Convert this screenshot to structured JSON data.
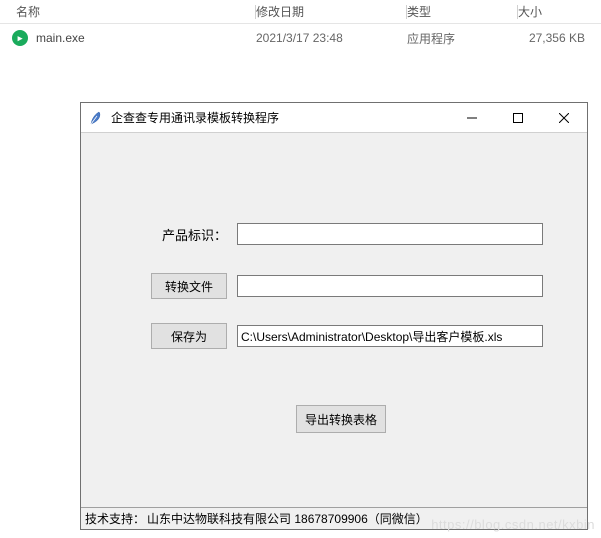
{
  "explorer": {
    "columns": {
      "name": "名称",
      "date": "修改日期",
      "type": "类型",
      "size": "大小"
    },
    "files": [
      {
        "name": "main.exe",
        "date": "2021/3/17 23:48",
        "type": "应用程序",
        "size": "27,356 KB"
      }
    ]
  },
  "window": {
    "title": "企查查专用通讯录模板转换程序",
    "labels": {
      "product_id": "产品标识：",
      "convert_file": "转换文件",
      "save_as": "保存为",
      "export": "导出转换表格"
    },
    "values": {
      "product_id": "",
      "convert_file": "",
      "save_as": "C:\\Users\\Administrator\\Desktop\\导出客户模板.xls"
    },
    "footer": {
      "label": "技术支持：",
      "text": "山东中达物联科技有限公司 18678709906（同微信）"
    }
  },
  "watermark": "https://blog.csdn.net/kxbin"
}
